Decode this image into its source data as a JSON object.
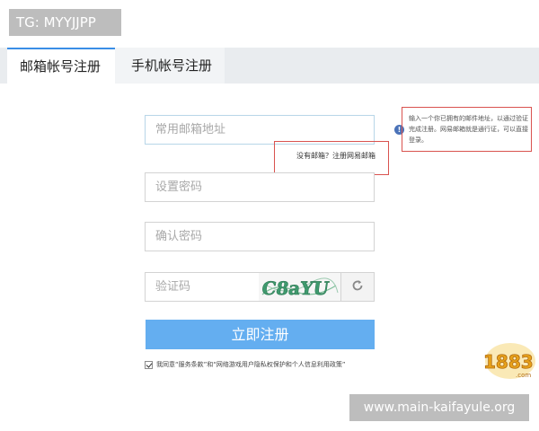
{
  "watermark": {
    "tg_label": "TG: MYYJJPP",
    "url": "www.main-kaifayule.org"
  },
  "tabs": [
    {
      "label": "邮箱帐号注册",
      "active": true
    },
    {
      "label": "手机帐号注册",
      "active": false
    }
  ],
  "form": {
    "email_placeholder": "常用邮箱地址",
    "password_placeholder": "设置密码",
    "confirm_placeholder": "确认密码",
    "captcha_placeholder": "验证码",
    "captcha_code": "C8aYU",
    "no_email_link": "没有邮箱？注册网易邮箱",
    "submit_label": "立即注册",
    "agree_text": "我同意“服务条款”和“网络游戏用户隐私权保护和个人信息利用政策”"
  },
  "hint": {
    "text": "输入一个你已拥有的邮件地址，以通过验证完成注册。网易邮箱就是通行证，可以直接登录。"
  },
  "logo": {
    "text": "1883",
    "sub": ".com"
  },
  "colors": {
    "tab_accent": "#3a8ee6",
    "submit_button": "#64aef0",
    "annotation_box": "#d9534f",
    "watermark_bg": "#bdbdbd"
  }
}
